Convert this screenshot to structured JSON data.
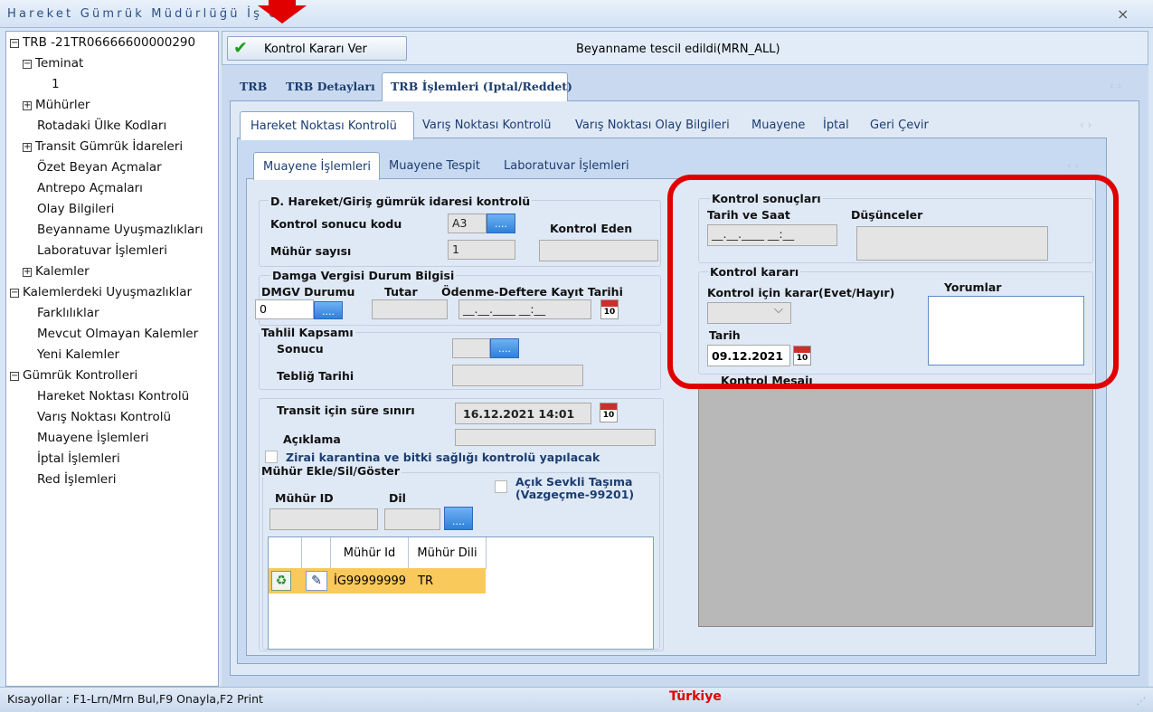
{
  "window": {
    "title": "Hareket Gümrük Müdürlüğü İşlemleri",
    "title_visible": "Hareket Gümrük Müdürlüğü İş           eri",
    "close": "×"
  },
  "tree": {
    "items": [
      {
        "label": "TRB -21TR06666600000290",
        "expander": "−"
      },
      {
        "label": "Teminat",
        "expander": "−"
      },
      {
        "label": "1"
      },
      {
        "label": "Mühürler",
        "expander": "+"
      },
      {
        "label": "Rotadaki Ülke Kodları"
      },
      {
        "label": "Transit Gümrük İdareleri",
        "expander": "+"
      },
      {
        "label": "Özet Beyan Açmalar"
      },
      {
        "label": "Antrepo Açmaları"
      },
      {
        "label": "Olay Bilgileri"
      },
      {
        "label": "Beyanname Uyuşmazlıkları"
      },
      {
        "label": "Laboratuvar İşlemleri"
      },
      {
        "label": "Kalemler",
        "expander": "+"
      },
      {
        "label": "Kalemlerdeki Uyuşmazlıklar",
        "expander": "−"
      },
      {
        "label": "Farklılıklar"
      },
      {
        "label": "Mevcut Olmayan Kalemler"
      },
      {
        "label": "Yeni Kalemler"
      },
      {
        "label": "Gümrük Kontrolleri",
        "expander": "−"
      },
      {
        "label": "Hareket Noktası Kontrolü"
      },
      {
        "label": "Varış Noktası Kontrolü"
      },
      {
        "label": "Muayene İşlemleri"
      },
      {
        "label": "İptal İşlemleri"
      },
      {
        "label": "Red İşlemleri"
      }
    ]
  },
  "toolbar": {
    "kontrol_button": "Kontrol Kararı Ver",
    "status_text": "Beyanname tescil edildi(MRN_ALL)"
  },
  "tabs_level1": [
    "TRB",
    "TRB Detayları",
    "TRB İşlemleri (Iptal/Reddet)"
  ],
  "tabs_level2": [
    "Hareket Noktası Kontrolü",
    "Varış Noktası Kontrolü",
    "Varış Noktası Olay Bilgileri",
    "Muayene",
    "İptal",
    "Geri Çevir"
  ],
  "tabs_level3": [
    "Muayene İşlemleri",
    "Muayene Tespit",
    "Laboratuvar  İşlemleri"
  ],
  "nav_arrows": "‹  ›",
  "form": {
    "group_dhareket": "D. Hareket/Giriş gümrük idaresi kontrolü",
    "kontrol_sonucu_kodu_label": "Kontrol sonucu kodu",
    "kontrol_sonucu_kodu_value": "A3",
    "kontrol_eden_label": "Kontrol Eden",
    "muhur_sayisi_label": "Mühür sayısı",
    "muhur_sayisi_value": "1",
    "dots": "....",
    "group_damga": "Damga Vergisi Durum Bilgisi",
    "dmgv_durumu_label": "DMGV Durumu",
    "tutar_label": "Tutar",
    "odenme_label": "Ödenme-Deftere Kayıt Tarihi",
    "dmgv_value": "0",
    "date_mask": "__.__.____ __:__",
    "group_tahlil": "Tahlil Kapsamı",
    "sonucu_label": "Sonucu",
    "teblig_label": "Tebliğ Tarihi",
    "transit_label": "Transit için süre sınırı",
    "transit_value": "16.12.2021 14:01",
    "aciklama_label": "Açıklama",
    "zirai_label": "Zirai karantina ve bitki sağlığı kontrolü yapılacak",
    "group_muhur": "Mühür Ekle/Sil/Göster",
    "acik_sevkli_label": "Açık Sevkli Taşıma\n(Vazgeçme-99201)",
    "muhur_id_label": "Mühür ID",
    "dil_label": "Dil",
    "calendar_day": "10"
  },
  "seal_grid": {
    "headers": [
      "",
      "",
      "Mühür Id",
      "Mühür Dili"
    ],
    "rows": [
      {
        "id": "İG99999999",
        "lang": "TR"
      }
    ]
  },
  "control": {
    "group_sonuclar": "Kontrol sonuçları",
    "tarih_saat_label": "Tarih ve Saat",
    "tarih_saat_mask": "__.__.____ __:__",
    "dusunceler_label": "Düşünceler",
    "group_karar": "Kontrol kararı",
    "karar_label": "Kontrol için karar(Evet/Hayır)",
    "yorumlar_label": "Yorumlar",
    "tarih_label": "Tarih",
    "tarih_value": "09.12.2021",
    "mesaj_label": "Kontrol Mesajı"
  },
  "statusbar": {
    "shortcuts": "Kısayollar : F1-Lrn/Mrn Bul,F9 Onayla,F2 Print",
    "country": "Türkiye"
  },
  "colors": {
    "highlight_red": "#e00000",
    "row_highlight": "#f9c95b",
    "accent_blue": "#1c3d70"
  }
}
